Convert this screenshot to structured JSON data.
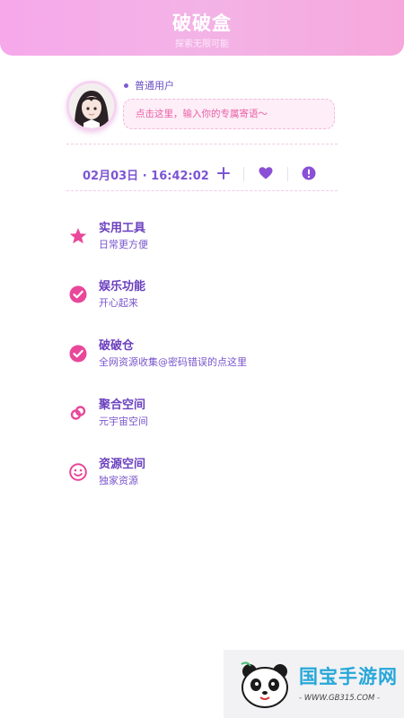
{
  "header": {
    "title": "破破盒",
    "subtitle": "探索无限可能"
  },
  "profile": {
    "user_type": "普通用户",
    "motto_placeholder": "点击这里，输入你的专属寄语～"
  },
  "status": {
    "datetime": "02月03日 · 16:42:02"
  },
  "actions": [
    {
      "icon": "plus-icon"
    },
    {
      "icon": "heart-icon"
    },
    {
      "icon": "alert-icon"
    }
  ],
  "menu": [
    {
      "title": "实用工具",
      "desc": "日常更方便",
      "icon": "star-icon"
    },
    {
      "title": "娱乐功能",
      "desc": "开心起来",
      "icon": "check-circle-icon"
    },
    {
      "title": "破破仓",
      "desc": "全网资源收集@密码错误的点这里",
      "icon": "check-circle-icon"
    },
    {
      "title": "聚合空间",
      "desc": "元宇宙空间",
      "icon": "link-icon"
    },
    {
      "title": "资源空间",
      "desc": "独家资源",
      "icon": "smile-icon"
    }
  ],
  "watermark": {
    "brand": "国宝手游网",
    "url": "- WWW.GB315.COM -"
  },
  "colors": {
    "accent": "#ea4d9b",
    "purple": "#7c55d2",
    "header": "#f3b3e6"
  }
}
